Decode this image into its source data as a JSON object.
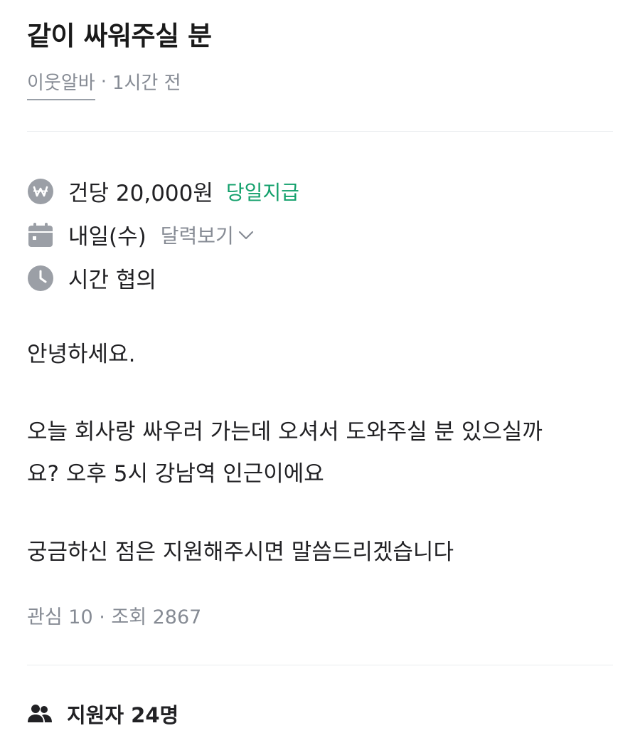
{
  "post": {
    "title": "같이 싸워주실 분",
    "author": "이웃알바",
    "separator": "·",
    "posted_time": "1시간 전"
  },
  "job_info": {
    "pay": {
      "icon": "won-icon",
      "text": "건당 20,000원",
      "badge": "당일지급",
      "badge_color": "#12a06b"
    },
    "date": {
      "icon": "calendar-icon",
      "text": "내일(수)",
      "calendar_link": "달력보기"
    },
    "time": {
      "icon": "clock-icon",
      "text": "시간 협의"
    }
  },
  "body": {
    "greeting": "안녕하세요.",
    "line1": "오늘 회사랑 싸우러 가는데 오셔서 도와주실 분 있으실까",
    "line2": "요? 오후 5시 강남역 인근이에요",
    "line3": "궁금하신 점은 지원해주시면 말씀드리겠습니다"
  },
  "stats": {
    "text": "관심 10 · 조회 2867"
  },
  "applicants": {
    "icon": "people-icon",
    "text": "지원자 24명"
  },
  "colors": {
    "text": "#212124",
    "muted": "#868b94",
    "icon_gray": "#9b9fa6",
    "divider": "#e9ecef",
    "accent_green": "#12a06b"
  }
}
